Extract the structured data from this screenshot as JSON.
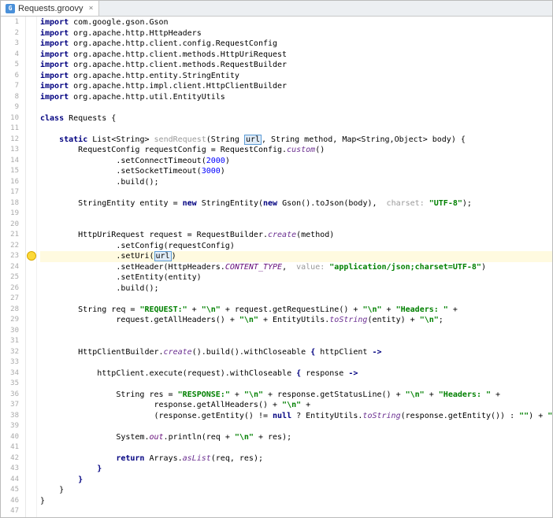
{
  "tab": {
    "title": "Requests.groovy",
    "icon": "G"
  },
  "code": {
    "lines": [
      {
        "n": 1,
        "segs": [
          {
            "t": "import ",
            "c": "kw"
          },
          {
            "t": "com.google.gson.Gson"
          }
        ]
      },
      {
        "n": 2,
        "segs": [
          {
            "t": "import ",
            "c": "kw"
          },
          {
            "t": "org.apache.http.HttpHeaders"
          }
        ]
      },
      {
        "n": 3,
        "segs": [
          {
            "t": "import ",
            "c": "kw"
          },
          {
            "t": "org.apache.http.client.config.RequestConfig"
          }
        ]
      },
      {
        "n": 4,
        "segs": [
          {
            "t": "import ",
            "c": "kw"
          },
          {
            "t": "org.apache.http.client.methods.HttpUriRequest"
          }
        ]
      },
      {
        "n": 5,
        "segs": [
          {
            "t": "import ",
            "c": "kw"
          },
          {
            "t": "org.apache.http.client.methods.RequestBuilder"
          }
        ]
      },
      {
        "n": 6,
        "segs": [
          {
            "t": "import ",
            "c": "kw"
          },
          {
            "t": "org.apache.http.entity.StringEntity"
          }
        ]
      },
      {
        "n": 7,
        "segs": [
          {
            "t": "import ",
            "c": "kw"
          },
          {
            "t": "org.apache.http.impl.client.HttpClientBuilder"
          }
        ]
      },
      {
        "n": 8,
        "segs": [
          {
            "t": "import ",
            "c": "kw"
          },
          {
            "t": "org.apache.http.util.EntityUtils"
          }
        ]
      },
      {
        "n": 9,
        "segs": []
      },
      {
        "n": 10,
        "segs": [
          {
            "t": "class ",
            "c": "kw"
          },
          {
            "t": "Requests {"
          }
        ]
      },
      {
        "n": 11,
        "segs": []
      },
      {
        "n": 12,
        "segs": [
          {
            "t": "    "
          },
          {
            "t": "static ",
            "c": "kw"
          },
          {
            "t": "List<String> "
          },
          {
            "t": "sendRequest",
            "c": "gray"
          },
          {
            "t": "(String "
          },
          {
            "t": "url",
            "c": "boxed"
          },
          {
            "t": ", String method, Map<String,Object> body) {"
          }
        ]
      },
      {
        "n": 13,
        "segs": [
          {
            "t": "        RequestConfig requestConfig = RequestConfig."
          },
          {
            "t": "custom",
            "c": "static"
          },
          {
            "t": "()"
          }
        ]
      },
      {
        "n": 14,
        "segs": [
          {
            "t": "                .setConnectTimeout("
          },
          {
            "t": "2000",
            "c": "num"
          },
          {
            "t": ")"
          }
        ]
      },
      {
        "n": 15,
        "segs": [
          {
            "t": "                .setSocketTimeout("
          },
          {
            "t": "3000",
            "c": "num"
          },
          {
            "t": ")"
          }
        ]
      },
      {
        "n": 16,
        "segs": [
          {
            "t": "                .build();"
          }
        ]
      },
      {
        "n": 17,
        "segs": []
      },
      {
        "n": 18,
        "segs": [
          {
            "t": "        StringEntity entity = "
          },
          {
            "t": "new ",
            "c": "kw"
          },
          {
            "t": "StringEntity("
          },
          {
            "t": "new ",
            "c": "kw"
          },
          {
            "t": "Gson().toJson(body),  "
          },
          {
            "t": "charset: ",
            "c": "gray"
          },
          {
            "t": "\"UTF-8\"",
            "c": "str"
          },
          {
            "t": ");"
          }
        ]
      },
      {
        "n": 19,
        "segs": []
      },
      {
        "n": 20,
        "segs": []
      },
      {
        "n": 21,
        "segs": [
          {
            "t": "        HttpUriRequest request = RequestBuilder."
          },
          {
            "t": "create",
            "c": "static"
          },
          {
            "t": "(method)"
          }
        ]
      },
      {
        "n": 22,
        "segs": [
          {
            "t": "                .setConfig(requestConfig)"
          }
        ]
      },
      {
        "n": 23,
        "hl": true,
        "segs": [
          {
            "t": "                .setUri("
          },
          {
            "t": "url",
            "c": "boxed"
          },
          {
            "t": ")"
          }
        ]
      },
      {
        "n": 24,
        "segs": [
          {
            "t": "                .setHeader(HttpHeaders."
          },
          {
            "t": "CONTENT_TYPE",
            "c": "purple"
          },
          {
            "t": ",  "
          },
          {
            "t": "value: ",
            "c": "gray"
          },
          {
            "t": "\"application/json;charset=UTF-8\"",
            "c": "str"
          },
          {
            "t": ")"
          }
        ]
      },
      {
        "n": 25,
        "segs": [
          {
            "t": "                .setEntity(entity)"
          }
        ]
      },
      {
        "n": 26,
        "segs": [
          {
            "t": "                .build();"
          }
        ]
      },
      {
        "n": 27,
        "segs": []
      },
      {
        "n": 28,
        "segs": [
          {
            "t": "        String req = "
          },
          {
            "t": "\"REQUEST:\"",
            "c": "str"
          },
          {
            "t": " + "
          },
          {
            "t": "\"\\n\"",
            "c": "str"
          },
          {
            "t": " + request.getRequestLine() + "
          },
          {
            "t": "\"\\n\"",
            "c": "str"
          },
          {
            "t": " + "
          },
          {
            "t": "\"Headers: \"",
            "c": "str"
          },
          {
            "t": " +"
          }
        ]
      },
      {
        "n": 29,
        "segs": [
          {
            "t": "                request.getAllHeaders() + "
          },
          {
            "t": "\"\\n\"",
            "c": "str"
          },
          {
            "t": " + EntityUtils."
          },
          {
            "t": "toString",
            "c": "static"
          },
          {
            "t": "(entity) + "
          },
          {
            "t": "\"\\n\"",
            "c": "str"
          },
          {
            "t": ";"
          }
        ]
      },
      {
        "n": 30,
        "segs": []
      },
      {
        "n": 31,
        "segs": []
      },
      {
        "n": 32,
        "segs": [
          {
            "t": "        HttpClientBuilder."
          },
          {
            "t": "create",
            "c": "static"
          },
          {
            "t": "().build().withCloseable "
          },
          {
            "t": "{",
            "c": "kw"
          },
          {
            "t": " httpClient "
          },
          {
            "t": "->",
            "c": "kw"
          }
        ]
      },
      {
        "n": 33,
        "segs": []
      },
      {
        "n": 34,
        "segs": [
          {
            "t": "            httpClient.execute(request).withCloseable "
          },
          {
            "t": "{",
            "c": "kw"
          },
          {
            "t": " response "
          },
          {
            "t": "->",
            "c": "kw"
          }
        ]
      },
      {
        "n": 35,
        "segs": []
      },
      {
        "n": 36,
        "segs": [
          {
            "t": "                String res = "
          },
          {
            "t": "\"RESPONSE:\"",
            "c": "str"
          },
          {
            "t": " + "
          },
          {
            "t": "\"\\n\"",
            "c": "str"
          },
          {
            "t": " + response.getStatusLine() + "
          },
          {
            "t": "\"\\n\"",
            "c": "str"
          },
          {
            "t": " + "
          },
          {
            "t": "\"Headers: \"",
            "c": "str"
          },
          {
            "t": " +"
          }
        ]
      },
      {
        "n": 37,
        "segs": [
          {
            "t": "                        response.getAllHeaders() + "
          },
          {
            "t": "\"\\n\"",
            "c": "str"
          },
          {
            "t": " +"
          }
        ]
      },
      {
        "n": 38,
        "segs": [
          {
            "t": "                        (response.getEntity() != "
          },
          {
            "t": "null ",
            "c": "kw"
          },
          {
            "t": "? EntityUtils."
          },
          {
            "t": "toString",
            "c": "static"
          },
          {
            "t": "(response.getEntity()) : "
          },
          {
            "t": "\"\"",
            "c": "str"
          },
          {
            "t": ") + "
          },
          {
            "t": "\"\\n\"",
            "c": "str"
          },
          {
            "t": ";"
          }
        ]
      },
      {
        "n": 39,
        "segs": []
      },
      {
        "n": 40,
        "segs": [
          {
            "t": "                System."
          },
          {
            "t": "out",
            "c": "purple"
          },
          {
            "t": ".println(req + "
          },
          {
            "t": "\"\\n\"",
            "c": "str"
          },
          {
            "t": " + res);"
          }
        ]
      },
      {
        "n": 41,
        "segs": []
      },
      {
        "n": 42,
        "segs": [
          {
            "t": "                "
          },
          {
            "t": "return ",
            "c": "kw"
          },
          {
            "t": "Arrays."
          },
          {
            "t": "asList",
            "c": "static"
          },
          {
            "t": "(req, res);"
          }
        ]
      },
      {
        "n": 43,
        "segs": [
          {
            "t": "            "
          },
          {
            "t": "}",
            "c": "kw"
          }
        ]
      },
      {
        "n": 44,
        "segs": [
          {
            "t": "        "
          },
          {
            "t": "}",
            "c": "kw"
          }
        ]
      },
      {
        "n": 45,
        "segs": [
          {
            "t": "    }"
          }
        ]
      },
      {
        "n": 46,
        "segs": [
          {
            "t": "}"
          }
        ]
      },
      {
        "n": 47,
        "segs": []
      }
    ]
  }
}
